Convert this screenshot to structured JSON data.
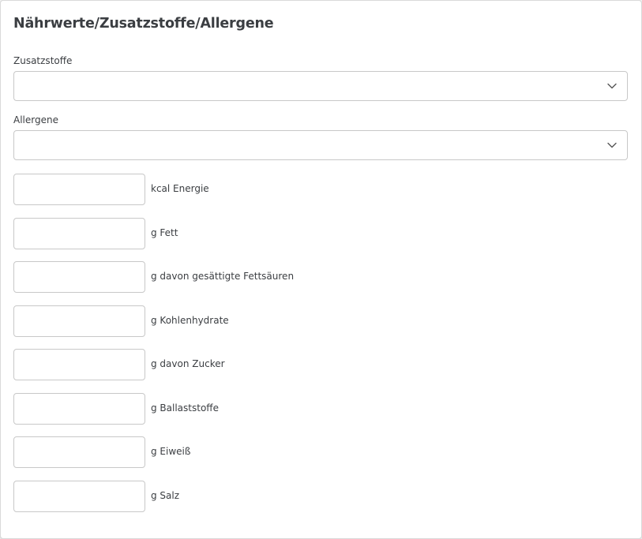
{
  "section": {
    "title": "Nährwerte/Zusatzstoffe/Allergene"
  },
  "additives": {
    "label": "Zusatzstoffe",
    "selected": ""
  },
  "allergens": {
    "label": "Allergene",
    "selected": ""
  },
  "nutrition": [
    {
      "label": "kcal Energie",
      "value": ""
    },
    {
      "label": "g Fett",
      "value": ""
    },
    {
      "label": "g davon gesättigte Fettsäuren",
      "value": ""
    },
    {
      "label": "g Kohlenhydrate",
      "value": ""
    },
    {
      "label": "g davon Zucker",
      "value": ""
    },
    {
      "label": "g Ballaststoffe",
      "value": ""
    },
    {
      "label": "g Eiweiß",
      "value": ""
    },
    {
      "label": "g Salz",
      "value": ""
    }
  ],
  "icons": {
    "dropdown": "chevron-down-icon"
  },
  "colors": {
    "text": "#3b3e42",
    "border": "#c8c8c8"
  }
}
